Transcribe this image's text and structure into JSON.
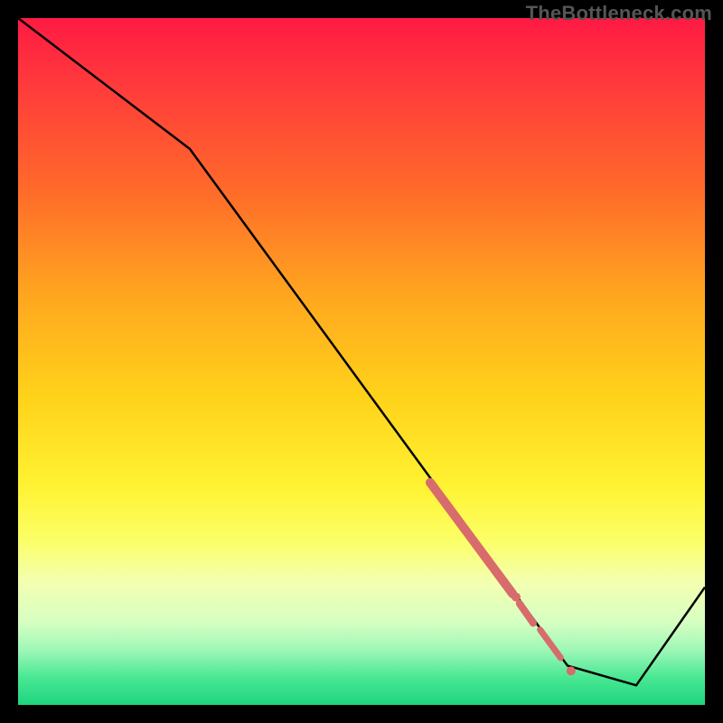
{
  "watermark": "TheBottleneck.com",
  "colors": {
    "frame": "#000000",
    "line": "#000000",
    "marker": "#d86b6b",
    "gradient_top": "#ff1a44",
    "gradient_bottom": "#1fd47f"
  },
  "chart_data": {
    "type": "line",
    "title": "",
    "xlabel": "",
    "ylabel": "",
    "xlim": [
      0,
      100
    ],
    "ylim": [
      0,
      105
    ],
    "series": [
      {
        "name": "curve",
        "x": [
          0,
          25,
          80,
          90,
          100
        ],
        "y": [
          105,
          85,
          6,
          3,
          18
        ]
      }
    ],
    "highlight_segments": [
      {
        "x0": 60,
        "y0": 34,
        "x1": 72,
        "y1": 17,
        "width": 10
      },
      {
        "x0": 73,
        "y0": 15.5,
        "x1": 75,
        "y1": 12.5,
        "width": 8
      },
      {
        "x0": 76,
        "y0": 11.5,
        "x1": 79,
        "y1": 7.2,
        "width": 7
      }
    ],
    "highlight_dots": [
      {
        "x": 80.5,
        "y": 5.2,
        "r": 5
      },
      {
        "x": 72.5,
        "y": 16.5,
        "r": 5
      }
    ]
  }
}
